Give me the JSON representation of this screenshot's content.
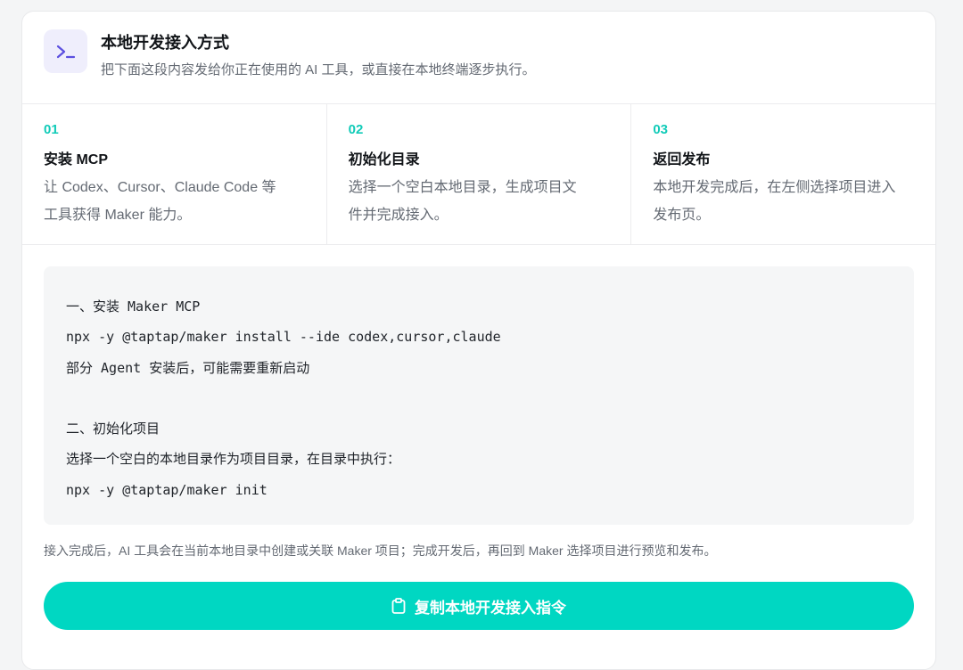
{
  "header": {
    "icon": "terminal-icon",
    "title": "本地开发接入方式",
    "subtitle": "把下面这段内容发给你正在使用的 AI 工具，或直接在本地终端逐步执行。"
  },
  "steps": [
    {
      "number": "01",
      "title": "安装 MCP",
      "desc_lines": [
        "让 Codex、Cursor、Claude Code 等",
        "工具获得 Maker 能力。"
      ]
    },
    {
      "number": "02",
      "title": "初始化目录",
      "desc_lines": [
        "选择一个空白本地目录，生成项目文",
        "件并完成接入。"
      ]
    },
    {
      "number": "03",
      "title": "返回发布",
      "desc_lines": [
        "本地开发完成后，在左侧选择项目进入",
        "发布页。"
      ]
    }
  ],
  "code_lines": [
    "一、安装 Maker MCP",
    "npx -y @taptap/maker install --ide codex,cursor,claude",
    "部分 Agent 安装后，可能需要重新启动",
    "",
    "二、初始化项目",
    "选择一个空白的本地目录作为项目目录，在目录中执行：",
    "npx -y @taptap/maker init"
  ],
  "footer_note": "接入完成后，AI 工具会在当前本地目录中创建或关联 Maker 项目；完成开发后，再回到 Maker 选择项目进行预览和发布。",
  "copy_button": {
    "icon": "clipboard-icon",
    "label": "复制本地开发接入指令"
  },
  "colors": {
    "accent": "#00d7c2",
    "step_number": "#11cbb8",
    "icon_bg": "#efeefc",
    "icon_fg": "#5b4fe0"
  }
}
